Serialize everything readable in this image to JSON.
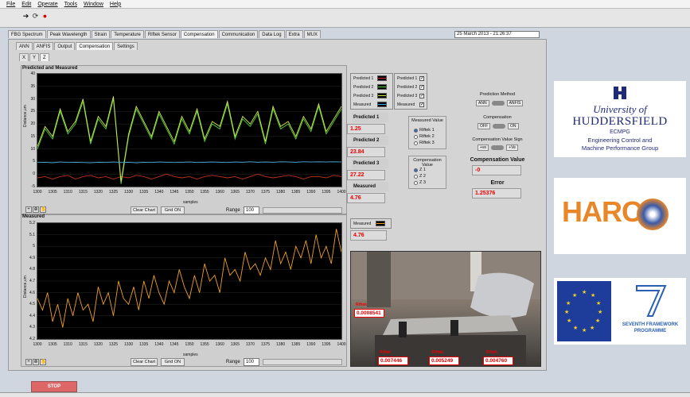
{
  "menu": [
    "File",
    "Edit",
    "Operate",
    "Tools",
    "Window",
    "Help"
  ],
  "tabs_main": [
    "FBG Spectrum",
    "Peak Wavelength",
    "Strain",
    "Temperature",
    "Riftek Sensor",
    "Compensation",
    "Communication",
    "Data Log",
    "Extra",
    "MUX"
  ],
  "tabs_main_active": "Compensation",
  "datetime": "25 March 2013 - 21:26:37",
  "tabs_sub": [
    "ANN",
    "ANFIS",
    "Output",
    "Compensation",
    "Settings"
  ],
  "tabs_sub_active": "Compensation",
  "tabs_axis": [
    "X",
    "Y",
    "Z"
  ],
  "graph1": {
    "title": "Predicted and Measured",
    "ylabel": "Distance,um",
    "xlabel": "samples",
    "clear_label": "Clear Chart",
    "grid_label": "Grid ON",
    "range_label": "Range",
    "range_value": "100"
  },
  "graph2": {
    "title": "Measured",
    "ylabel": "Distance,um",
    "xlabel": "samples",
    "clear_label": "Clear Chart",
    "grid_label": "Grid ON",
    "range_label": "Range",
    "range_value": "100"
  },
  "legend1": [
    "Predicted 1",
    "Predicted 2",
    "Predicted 3",
    "Measured"
  ],
  "legend1_checks": [
    "Predicted 1",
    "Predicted 2",
    "Predicted 3",
    "Measured"
  ],
  "legend2": "Measured",
  "predicted1_label": "Predicted 1",
  "predicted1_value": "1.25",
  "predicted2_label": "Predicted 2",
  "predicted2_value": "23.84",
  "predicted3_label": "Predicted 3",
  "predicted3_value": "27.22",
  "measured_label": "Measured",
  "measured_value": "4.76",
  "measured_value2": "4.76",
  "measured_value_group": {
    "title": "Measured Value",
    "options": [
      "Riftek 1",
      "Riftek 2",
      "Riftek 3"
    ],
    "selected": 0
  },
  "comp_value_group": {
    "title": "Compensation Value",
    "options": [
      "Z 1",
      "Z 2",
      "Z 3"
    ],
    "selected": 0
  },
  "prediction_method": {
    "title": "Prediction Method",
    "left": "ANN",
    "right": "ANFIS"
  },
  "compensation": {
    "title": "Compensation",
    "left": "OFF",
    "right": "ON"
  },
  "comp_sign": {
    "title": "Compensation Value Sign",
    "left": "+ve",
    "right": "+Ve"
  },
  "compensation_value": {
    "label": "Compensation Value",
    "value": "-0"
  },
  "error": {
    "label": "Error",
    "value": "1.25376"
  },
  "photo": {
    "values": [
      "0.0008541",
      "0.007446",
      "0.005249",
      "0.004760"
    ],
    "labels": [
      "Riftek",
      "Riftek",
      "Riftek",
      "Riftek"
    ]
  },
  "logos": {
    "university": "University of",
    "huddersfield": "HUDDERSFIELD",
    "ecmpg": "ECMPG",
    "ecmpg_line1": "Engineering Control and",
    "ecmpg_line2": "Machine Performance Group",
    "harco": "HARC",
    "fp7_line1": "SEVENTH FRAMEWORK",
    "fp7_line2": "PROGRAMME"
  },
  "stop_label": "STOP",
  "chart_data": [
    {
      "type": "line",
      "title": "Predicted and Measured",
      "xlabel": "samples",
      "ylabel": "Distance,um",
      "xlim": [
        1300,
        1400
      ],
      "ylim": [
        -5,
        40
      ],
      "xticks": [
        1300,
        1305,
        1310,
        1315,
        1320,
        1325,
        1330,
        1335,
        1340,
        1345,
        1350,
        1355,
        1360,
        1365,
        1370,
        1375,
        1380,
        1385,
        1390,
        1395,
        1400
      ],
      "yticks": [
        -5,
        0,
        5,
        10,
        15,
        20,
        25,
        30,
        35,
        40
      ],
      "series": [
        {
          "name": "Predicted 1",
          "color": "#c0301a",
          "values": [
            -1.5,
            -1,
            -2,
            -1,
            -0.5,
            -2,
            -1,
            -0.5,
            -1.5,
            -1,
            -2,
            -1,
            -1.5,
            -0.5,
            -1,
            -2,
            -1,
            0,
            -1,
            -1.5,
            -1,
            -2,
            -1,
            -0.5,
            -1,
            -1.5,
            -1,
            -2,
            -1,
            0,
            -1,
            -1.5,
            -1,
            -0.5,
            -1,
            -2,
            -1,
            -1,
            -1.5,
            -0.5,
            -1
          ]
        },
        {
          "name": "Predicted 2",
          "color": "#4fd23a",
          "values": [
            10,
            18,
            14,
            25,
            16,
            20,
            29,
            12,
            22,
            18,
            30,
            -4,
            15,
            26,
            20,
            14,
            24,
            18,
            12,
            22,
            16,
            25,
            13,
            20,
            18,
            28,
            14,
            22,
            19,
            24,
            12,
            26,
            18,
            20,
            14,
            22,
            17,
            27,
            16,
            21,
            26
          ]
        },
        {
          "name": "Predicted 3",
          "color": "#d2e84a",
          "values": [
            11,
            19,
            15,
            26,
            17,
            21,
            30,
            13,
            23,
            19,
            31,
            -3,
            16,
            27,
            21,
            15,
            25,
            19,
            13,
            23,
            17,
            26,
            14,
            21,
            19,
            29,
            15,
            23,
            20,
            25,
            13,
            27,
            19,
            21,
            15,
            23,
            18,
            28,
            17,
            22,
            27
          ]
        },
        {
          "name": "Measured",
          "color": "#3fa8d8",
          "values": [
            4.6,
            4.7,
            4.5,
            4.8,
            4.6,
            4.7,
            4.6,
            4.5,
            4.7,
            4.6,
            4.8,
            4.6,
            4.7,
            4.5,
            4.7,
            4.6,
            4.8,
            4.7,
            4.6,
            4.7,
            4.8,
            4.6,
            4.7,
            4.8,
            4.7,
            4.6,
            4.8,
            4.7,
            4.9,
            4.7,
            4.8,
            4.7,
            4.9,
            4.8,
            4.7,
            4.9,
            4.8,
            4.9,
            4.8,
            4.9,
            4.8
          ]
        }
      ]
    },
    {
      "type": "line",
      "title": "Measured",
      "xlabel": "samples",
      "ylabel": "Distance,um",
      "xlim": [
        1300,
        1400
      ],
      "ylim": [
        4.2,
        5.2
      ],
      "xticks": [
        1300,
        1305,
        1310,
        1315,
        1320,
        1325,
        1330,
        1335,
        1340,
        1345,
        1350,
        1355,
        1360,
        1365,
        1370,
        1375,
        1380,
        1385,
        1390,
        1395,
        1400
      ],
      "yticks": [
        4.2,
        4.3,
        4.4,
        4.5,
        4.6,
        4.7,
        4.8,
        4.9,
        5,
        5.1,
        5.2
      ],
      "series": [
        {
          "name": "Measured",
          "color": "#f0a020",
          "values": [
            4.55,
            4.45,
            4.6,
            4.35,
            4.5,
            4.3,
            4.55,
            4.4,
            4.6,
            4.45,
            4.5,
            4.35,
            4.65,
            4.5,
            4.6,
            4.4,
            4.7,
            4.55,
            4.5,
            4.65,
            4.45,
            4.7,
            4.55,
            4.75,
            4.6,
            4.5,
            4.7,
            4.6,
            4.8,
            4.65,
            4.55,
            4.75,
            4.6,
            4.85,
            4.7,
            4.75,
            4.6,
            4.9,
            4.75,
            4.8,
            4.7,
            4.95,
            4.8,
            4.85,
            4.75,
            4.9,
            4.8,
            5.05,
            4.85,
            4.95,
            4.8,
            5.0,
            4.9,
            5.05,
            4.85,
            5.1,
            4.9,
            5.0,
            4.85,
            5.15,
            4.95
          ]
        }
      ]
    }
  ]
}
